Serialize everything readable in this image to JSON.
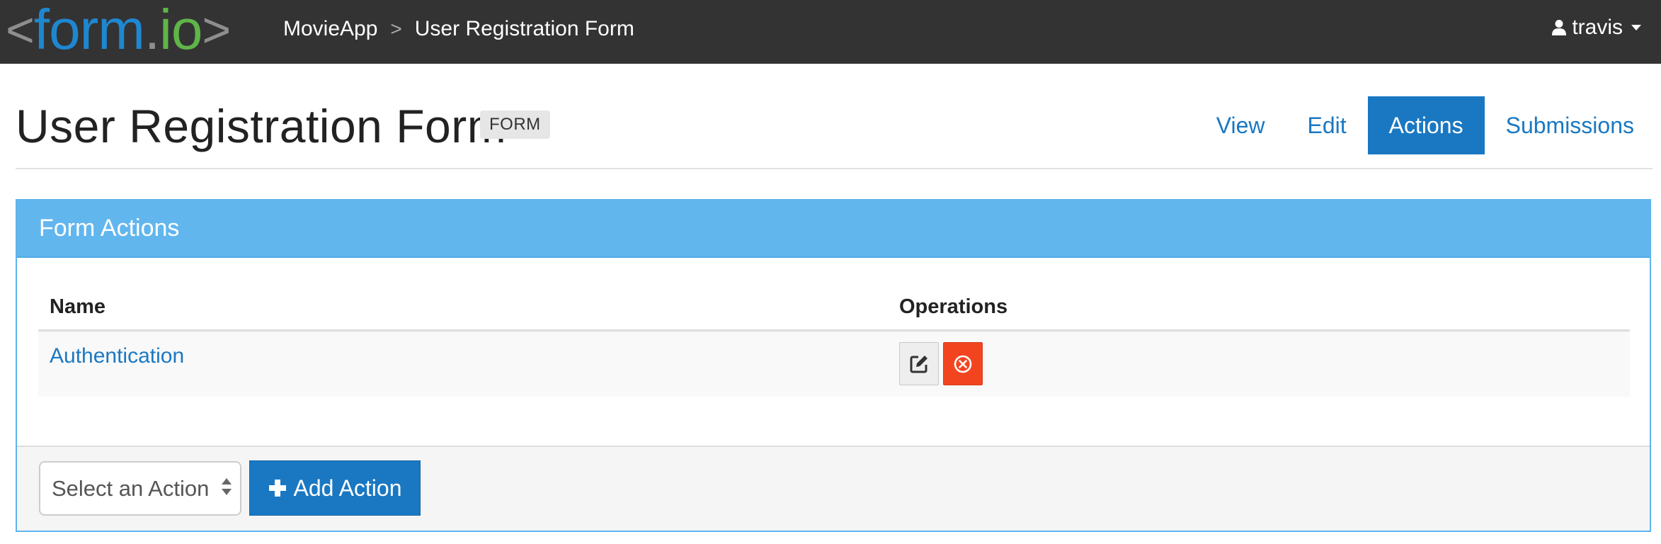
{
  "navbar": {
    "logo": {
      "open_bracket": "<",
      "word1": "form",
      "dot": ".",
      "word2": "io",
      "close_bracket": ">"
    },
    "breadcrumb": {
      "project": "MovieApp",
      "separator": ">",
      "current": "User Registration Form"
    },
    "user": {
      "name": "travis",
      "icon": "user-icon"
    }
  },
  "header": {
    "title": "User Registration Form",
    "badge": "FORM",
    "tabs": [
      {
        "label": "View",
        "active": false
      },
      {
        "label": "Edit",
        "active": false
      },
      {
        "label": "Actions",
        "active": true
      },
      {
        "label": "Submissions",
        "active": false
      }
    ]
  },
  "panel": {
    "title": "Form Actions",
    "table": {
      "columns": [
        "Name",
        "Operations"
      ],
      "rows": [
        {
          "name": "Authentication",
          "operations": [
            "edit-icon",
            "delete-icon"
          ]
        }
      ]
    },
    "footer": {
      "select_value": "Select an Action",
      "add_button_label": "Add Action"
    }
  },
  "colors": {
    "navbar_bg": "#333333",
    "logo_blue": "#1e87d0",
    "logo_green": "#5fb548",
    "primary": "#1a78c2",
    "panel_header": "#62b6ee",
    "danger": "#f2451f"
  }
}
